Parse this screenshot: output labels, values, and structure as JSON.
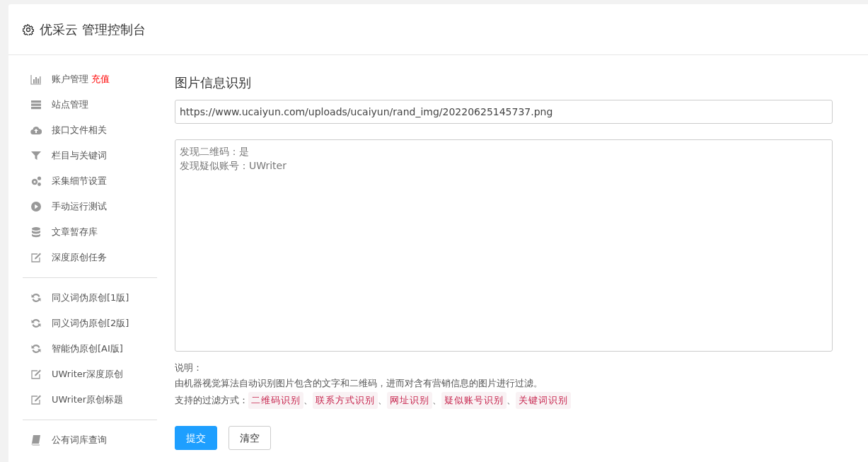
{
  "header": {
    "title": "优采云 管理控制台"
  },
  "sidebar": {
    "groups": [
      {
        "items": [
          {
            "label": "账户管理",
            "badge": "充值"
          },
          {
            "label": "站点管理"
          },
          {
            "label": "接口文件相关"
          },
          {
            "label": "栏目与关键词"
          },
          {
            "label": "采集细节设置"
          },
          {
            "label": "手动运行测试"
          },
          {
            "label": "文章暂存库"
          },
          {
            "label": "深度原创任务"
          }
        ]
      },
      {
        "items": [
          {
            "label": "同义词伪原创[1版]"
          },
          {
            "label": "同义词伪原创[2版]"
          },
          {
            "label": "智能伪原创[AI版]"
          },
          {
            "label": "UWriter深度原创"
          },
          {
            "label": "UWriter原创标题"
          }
        ]
      },
      {
        "items": [
          {
            "label": "公有词库查询"
          }
        ]
      }
    ]
  },
  "main": {
    "heading": "图片信息识别",
    "url_field": {
      "value": "https://www.ucaiyun.com/uploads/ucaiyun/rand_img/20220625145737.png"
    },
    "result_box": {
      "lines": [
        "发现二维码：是",
        "发现疑似账号：UWriter"
      ]
    },
    "notes": {
      "title": "说明：",
      "description": "由机器视觉算法自动识别图片包含的文字和二维码，进而对含有营销信息的图片进行过滤。",
      "filters_label": "支持的过滤方式：",
      "filters": [
        {
          "text": "二维码识别",
          "separator": "、"
        },
        {
          "text": "联系方式识别",
          "separator": "、"
        },
        {
          "text": "网址识别",
          "separator": "、"
        },
        {
          "text": "疑似账号识别",
          "separator": "、"
        },
        {
          "text": "关键词识别"
        }
      ]
    },
    "buttons": [
      {
        "label": "提交",
        "kind": "primary"
      },
      {
        "label": "清空",
        "kind": "default"
      }
    ]
  }
}
